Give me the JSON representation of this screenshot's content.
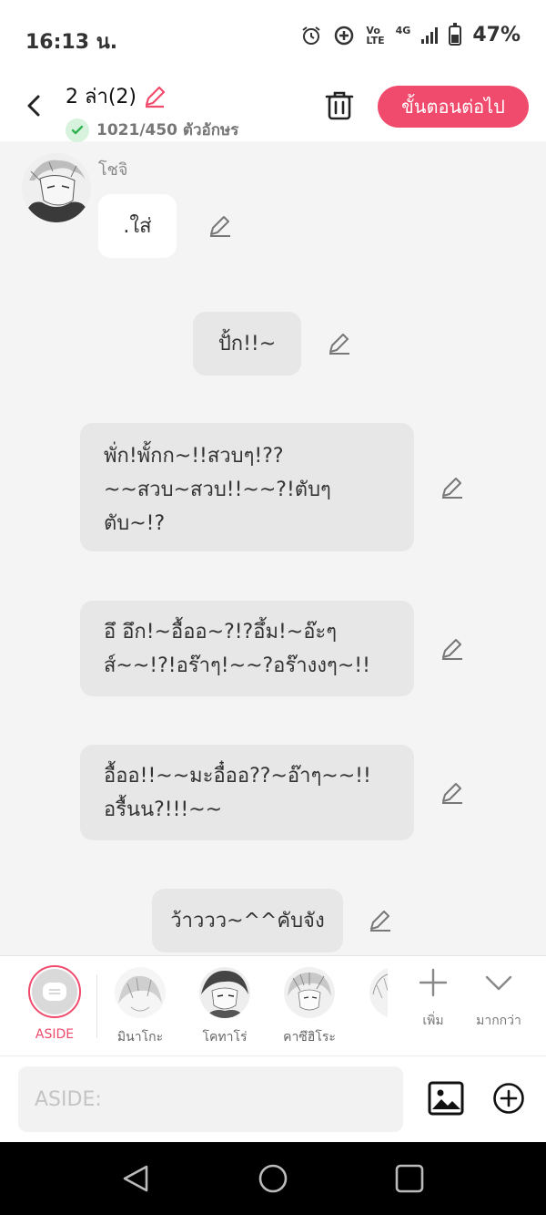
{
  "status_bar": {
    "time": "16:13 น.",
    "net_top": "Vo",
    "net_bottom": "LTE",
    "network": "4G",
    "battery": "47%"
  },
  "header": {
    "title": "2 ล่า(2)",
    "char_count": "1021/450 ตัวอักษร",
    "next_label": "ขั้นตอนต่อไป"
  },
  "chat": {
    "sender_name": "โชจิ",
    "messages": [
      {
        "text": ".ใส่"
      },
      {
        "text": "ปั้ก!!~"
      },
      {
        "text": "พั่ก!พั้กก~!!สวบๆ!??\n~~สวบ~สวบ!!~~?!ตับๆ\nตับ~!?"
      },
      {
        "text": "อึ อึก!~อื้ออ~?!?อึ้ม!~อ๊ะๆ\nส์~~!?!อร๊าๆ!~~?อร๊างงๆ~!!"
      },
      {
        "text": "อื้ออ!!~~มะอื๋ออ??~อ๊าๆ~~!!\nอรื้นน?!!!~~"
      },
      {
        "text": "ว้าววว~^^คับจัง"
      }
    ]
  },
  "characters": [
    {
      "name": "ASIDE"
    },
    {
      "name": "มินาโกะ"
    },
    {
      "name": "โคทาโร่"
    },
    {
      "name": "คาซึฮิโระ"
    }
  ],
  "char_bar": {
    "add_label": "เพิ่ม",
    "more_label": "มากกว่า"
  },
  "input": {
    "placeholder": "ASIDE:"
  },
  "colors": {
    "accent": "#f04a6c",
    "bubble_white": "#ffffff",
    "bubble_grey": "#e7e7e7",
    "background": "#f4f4f4"
  }
}
